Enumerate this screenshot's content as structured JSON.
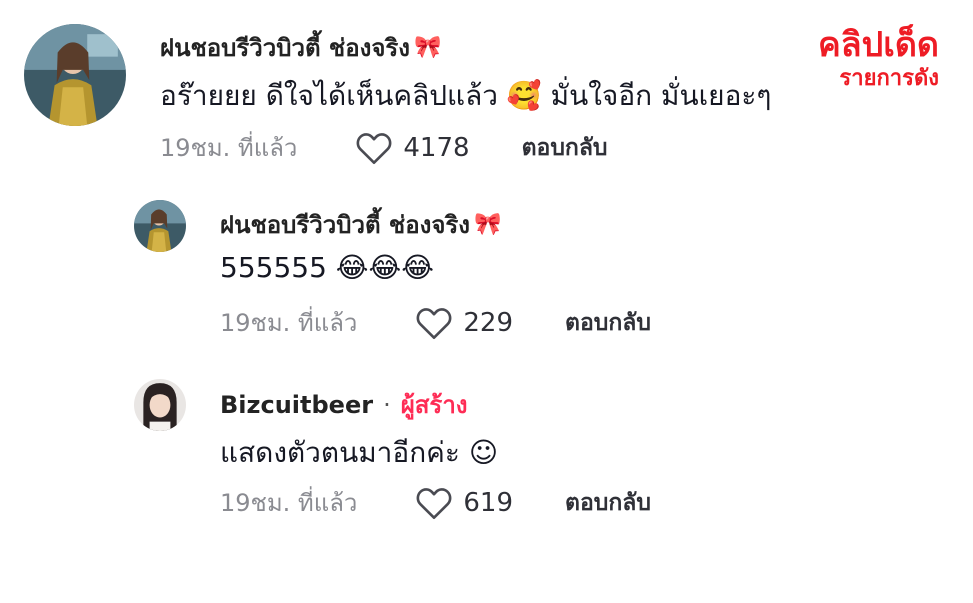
{
  "watermark": {
    "line1": "คลิปเด็ด",
    "line2": "รายการดัง"
  },
  "comments": [
    {
      "username": "ฝนชอบรีวิวบิวตี้ ช่องจริง",
      "name_emoji": "🎀",
      "text": "อร๊ายยย ดีใจได้เห็นคลิปแล้ว 🥰 มั่นใจอีก มั่นเยอะๆ",
      "time": "19ชม. ที่แล้ว",
      "likes": "4178",
      "reply_label": "ตอบกลับ",
      "avatar_icon": "profile-photo-gold-dress"
    },
    {
      "username": "ฝนชอบรีวิวบิวตี้ ช่องจริง",
      "name_emoji": "🎀",
      "text": "555555 😂😂😂",
      "time": "19ชม. ที่แล้ว",
      "likes": "229",
      "reply_label": "ตอบกลับ",
      "avatar_icon": "profile-photo-gold-dress"
    },
    {
      "username": "Bizcuitbeer",
      "separator": "·",
      "creator_label": "ผู้สร้าง",
      "text": "แสดงตัวตนมาอีกค่ะ ☺",
      "time": "19ชม. ที่แล้ว",
      "likes": "619",
      "reply_label": "ตอบกลับ",
      "avatar_icon": "profile-photo-dark-hair"
    }
  ],
  "icons": {
    "like": "heart-outline-icon"
  },
  "colors": {
    "creator": "#fe2c55",
    "watermark": "#ee1c25",
    "muted": "#8a8b91"
  }
}
